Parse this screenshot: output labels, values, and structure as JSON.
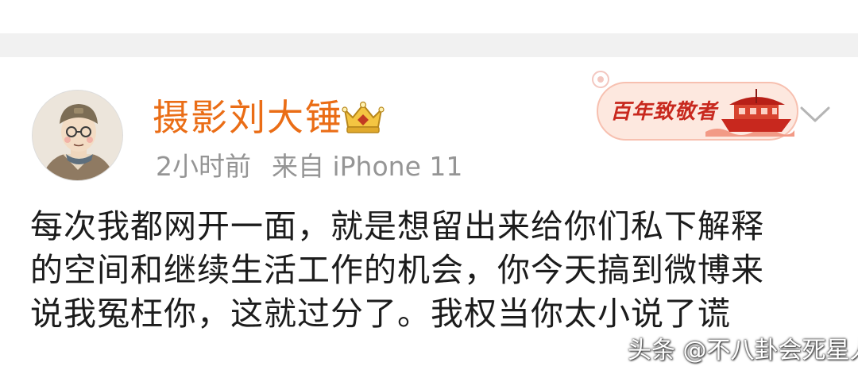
{
  "post": {
    "username": "摄影刘大锤",
    "time": "2小时前",
    "source": "来自 iPhone 11",
    "body_lines": [
      "每次我都网开一面，就是想留出来给你们私下解释",
      "的空间和继续生活工作的机会，你今天搞到微博来",
      "说我冤枉你，这就过分了。我权当你太小说了谎"
    ]
  },
  "badge": {
    "text": "百年致敬者"
  },
  "watermark": {
    "text": "头条 @不八卦会死星人"
  },
  "colors": {
    "username": "#ea6d16",
    "meta": "#959595",
    "body": "#1c1c1c",
    "badge_red": "#c8281e"
  }
}
